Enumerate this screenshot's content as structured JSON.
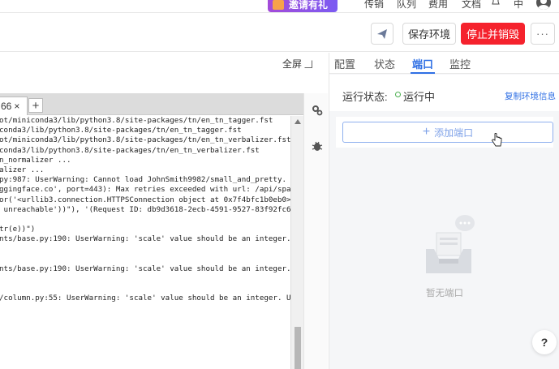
{
  "topnav": {
    "promo_label": "邀请有礼",
    "items": [
      "传销",
      "队列",
      "费用",
      "文档"
    ],
    "lang": "中"
  },
  "toolbar": {
    "send_icon": "paper-plane-icon",
    "save_label": "保存环境",
    "stop_label": "停止并销毁",
    "more_label": "···"
  },
  "editor": {
    "fullscreen_label": "全屏",
    "tab_label": "66",
    "tab_close": "×",
    "tab_add": "+",
    "terminal_lines": [
      "ot/miniconda3/lib/python3.8/site-packages/tn/en_tn_tagger.fst",
      "conda3/lib/python3.8/site-packages/tn/en_tn_tagger.fst",
      "ot/miniconda3/lib/python3.8/site-packages/tn/en_tn_verbalizer.fst",
      "conda3/lib/python3.8/site-packages/tn/en_tn_verbalizer.fst",
      "n_normalizer ...",
      "alizer ...",
      "py:987: UserWarning: Cannot load JohnSmith9982/small_and_pretty. Cau",
      "ggingface.co', port=443): Max retries exceeded with url: /api/spaces",
      "or('<urllib3.connection.HTTPSConnection object at 0x7f4bfc1b0eb0>: F",
      " unreachable'))\"), '(Request ID: db9d3618-2ecb-4591-9527-83f92fc642d",
      "",
      "tr(e))\")",
      "nts/base.py:190: UserWarning: 'scale' value should be an integer. Us",
      "",
      "",
      "nts/base.py:190: UserWarning: 'scale' value should be an integer. Us",
      "",
      "",
      "/column.py:55: UserWarning: 'scale' value should be an integer. Usin"
    ]
  },
  "panel": {
    "tabs": [
      "配置",
      "状态",
      "端口",
      "监控"
    ],
    "active_tab": "端口",
    "status_label": "运行状态:",
    "status_value": "运行中",
    "copy_link": "复制环境信息",
    "add_port_label": "添加端口",
    "empty_text": "暂无端口",
    "help_label": "?"
  },
  "colors": {
    "accent": "#2f6fe4",
    "danger": "#f5222d",
    "running": "#4caf50"
  }
}
